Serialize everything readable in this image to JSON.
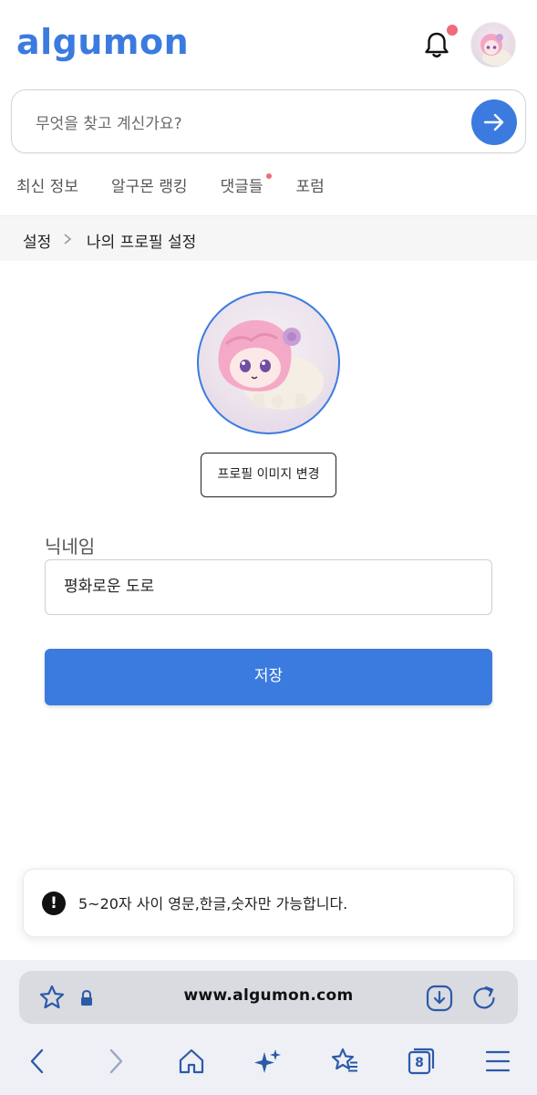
{
  "header": {
    "logo_text": "algumon",
    "notification_has_unread": true,
    "accent_color": "#3b7be0",
    "badge_color": "#ef6b7b"
  },
  "search": {
    "placeholder": "무엇을 찾고 계신가요?"
  },
  "nav_tabs": [
    {
      "label": "최신 정보",
      "has_dot": false
    },
    {
      "label": "알구몬 랭킹",
      "has_dot": false
    },
    {
      "label": "댓글들",
      "has_dot": true
    },
    {
      "label": "포럼",
      "has_dot": false
    }
  ],
  "breadcrumb": {
    "parent": "설정",
    "current": "나의 프로필 설정"
  },
  "profile": {
    "change_image_label": "프로필 이미지 변경",
    "nickname_label": "닉네임",
    "nickname_value": "평화로운 도로",
    "save_label": "저장"
  },
  "toast": {
    "icon": "exclamation-icon",
    "message": "5~20자 사이 영문,한글,숫자만 가능합니다."
  },
  "browser": {
    "url": "www.algumon.com",
    "tab_count": "8"
  }
}
